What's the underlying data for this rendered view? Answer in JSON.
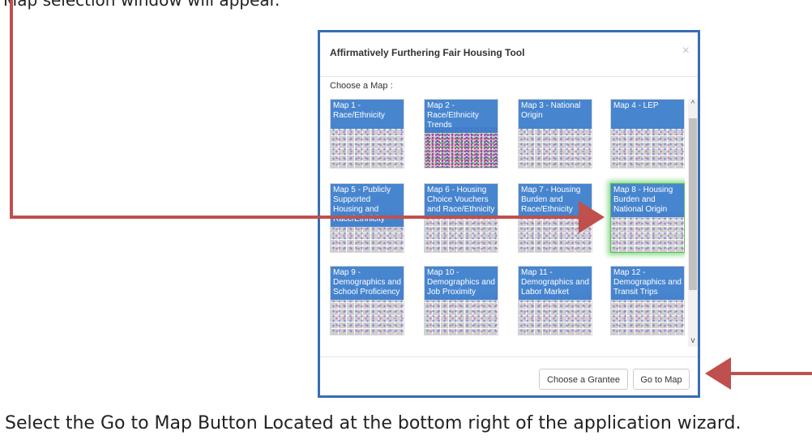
{
  "captions": {
    "top": "Map selection window will appear.",
    "bottom": "Select the Go to Map Button Located at the bottom right of the application wizard."
  },
  "dialog": {
    "title": "Affirmatively Furthering Fair Housing Tool",
    "close_glyph": "×",
    "choose_label": "Choose a Map :",
    "maps": [
      {
        "label": "Map 1 - Race/Ethnicity",
        "thumb": "dots",
        "selected": false
      },
      {
        "label": "Map 2 - Race/Ethnicity Trends",
        "thumb": "dense",
        "selected": false
      },
      {
        "label": "Map 3 - National Origin",
        "thumb": "dots",
        "selected": false
      },
      {
        "label": "Map 4 - LEP",
        "thumb": "dots",
        "selected": false
      },
      {
        "label": "Map 5 - Publicly Supported Housing and Race/Ethnicity",
        "thumb": "dots",
        "selected": false
      },
      {
        "label": "Map 6 - Housing Choice Vouchers and Race/Ethnicity",
        "thumb": "dots",
        "selected": false
      },
      {
        "label": "Map 7 - Housing Burden and Race/Ethnicity",
        "thumb": "dots",
        "selected": false
      },
      {
        "label": "Map 8 - Housing Burden and National Origin",
        "thumb": "dots",
        "selected": true
      },
      {
        "label": "Map 9 - Demographics and School Proficiency",
        "thumb": "dots",
        "selected": false
      },
      {
        "label": "Map 10 - Demographics and Job Proximity",
        "thumb": "dots",
        "selected": false
      },
      {
        "label": "Map 11 - Demographics and Labor Market",
        "thumb": "dots",
        "selected": false
      },
      {
        "label": "Map 12 - Demographics and Transit Trips",
        "thumb": "dots",
        "selected": false
      }
    ],
    "buttons": {
      "choose_grantee": "Choose a Grantee",
      "go_to_map": "Go to Map"
    }
  },
  "scrollbar": {
    "up": "^",
    "down": "v"
  },
  "colors": {
    "annotation_arrow": "#c0504d",
    "dialog_border": "#3a6db3",
    "card_label": "#3a7dcc",
    "selected_glow": "#8fdc8f"
  }
}
